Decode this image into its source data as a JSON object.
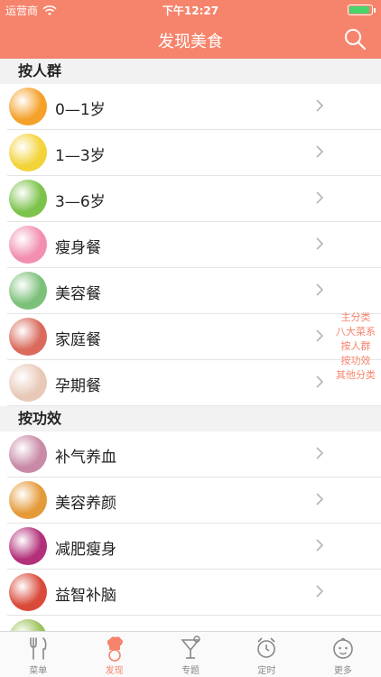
{
  "status_bar": {
    "carrier": "运营商",
    "time": "下午12:27",
    "battery_level": 0.9
  },
  "nav": {
    "title": "发现美食"
  },
  "sections": [
    {
      "header": "按人群",
      "items": [
        {
          "label": "0—1岁",
          "color": "#f4a12a"
        },
        {
          "label": "1—3岁",
          "color": "#f3d33a"
        },
        {
          "label": "3—6岁",
          "color": "#7cc34c"
        },
        {
          "label": "瘦身餐",
          "color": "#f28fb0"
        },
        {
          "label": "美容餐",
          "color": "#7cc07a"
        },
        {
          "label": "家庭餐",
          "color": "#d96a5c"
        },
        {
          "label": "孕期餐",
          "color": "#e8c9b8"
        }
      ]
    },
    {
      "header": "按功效",
      "items": [
        {
          "label": "补气养血",
          "color": "#c88aa6"
        },
        {
          "label": "美容养颜",
          "color": "#e59a3a"
        },
        {
          "label": "减肥瘦身",
          "color": "#b3307a"
        },
        {
          "label": "益智补脑",
          "color": "#d94a3a"
        },
        {
          "label": "",
          "color": "#9cc35a"
        }
      ]
    }
  ],
  "index": [
    "主分类",
    "八大菜系",
    "按人群",
    "按功效",
    "其他分类"
  ],
  "tabs": [
    {
      "label": "菜单",
      "icon": "fork-knife-icon",
      "active": false
    },
    {
      "label": "发现",
      "icon": "chef-icon",
      "active": true
    },
    {
      "label": "专题",
      "icon": "cocktail-icon",
      "active": false
    },
    {
      "label": "定时",
      "icon": "alarm-clock-icon",
      "active": false
    },
    {
      "label": "更多",
      "icon": "baby-face-icon",
      "active": false
    }
  ],
  "accent_color": "#f6846c"
}
